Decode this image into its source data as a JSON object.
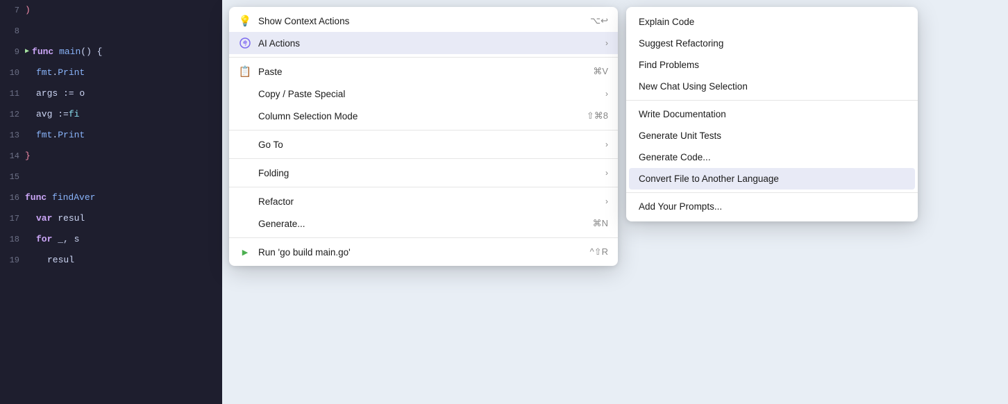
{
  "editor": {
    "lines": [
      {
        "num": "7",
        "content": ")",
        "type": "bracket",
        "hasRun": false
      },
      {
        "num": "8",
        "content": "",
        "type": "empty",
        "hasRun": false
      },
      {
        "num": "9",
        "content": "func main() {",
        "type": "func",
        "hasRun": true
      },
      {
        "num": "10",
        "content": "    fmt.Print",
        "type": "code",
        "hasRun": false
      },
      {
        "num": "11",
        "content": "    args := o",
        "type": "code",
        "hasRun": false
      },
      {
        "num": "12",
        "content": "    avg := fi",
        "type": "code",
        "hasRun": false
      },
      {
        "num": "13",
        "content": "    fmt.Print",
        "type": "code",
        "hasRun": false
      },
      {
        "num": "14",
        "content": "}",
        "type": "bracket",
        "hasRun": false
      },
      {
        "num": "15",
        "content": "",
        "type": "empty",
        "hasRun": false
      },
      {
        "num": "16",
        "content": "func findAver",
        "type": "func",
        "hasRun": false
      },
      {
        "num": "17",
        "content": "    var resul",
        "type": "code",
        "hasRun": false
      },
      {
        "num": "18",
        "content": "    for _, s",
        "type": "code",
        "hasRun": false
      },
      {
        "num": "19",
        "content": "        resul",
        "type": "code",
        "hasRun": false
      }
    ]
  },
  "contextMenu": {
    "items": [
      {
        "id": "show-context-actions",
        "icon": "💡",
        "label": "Show Context Actions",
        "shortcut": "⌥↩",
        "hasArrow": false,
        "isDivider": false,
        "isHighlighted": false,
        "isRunItem": false
      },
      {
        "id": "ai-actions",
        "icon": "ai",
        "label": "AI Actions",
        "shortcut": "",
        "hasArrow": true,
        "isDivider": false,
        "isHighlighted": true,
        "isRunItem": false
      },
      {
        "id": "div1",
        "isDivider": true
      },
      {
        "id": "paste",
        "icon": "📋",
        "label": "Paste",
        "shortcut": "⌘V",
        "hasArrow": false,
        "isDivider": false,
        "isHighlighted": false,
        "isRunItem": false
      },
      {
        "id": "copy-paste-special",
        "icon": "",
        "label": "Copy / Paste Special",
        "shortcut": "",
        "hasArrow": true,
        "isDivider": false,
        "isHighlighted": false,
        "isRunItem": false
      },
      {
        "id": "column-selection",
        "icon": "",
        "label": "Column Selection Mode",
        "shortcut": "⇧⌘8",
        "hasArrow": false,
        "isDivider": false,
        "isHighlighted": false,
        "isRunItem": false
      },
      {
        "id": "div2",
        "isDivider": true
      },
      {
        "id": "go-to",
        "icon": "",
        "label": "Go To",
        "shortcut": "",
        "hasArrow": true,
        "isDivider": false,
        "isHighlighted": false,
        "isRunItem": false
      },
      {
        "id": "div3",
        "isDivider": true
      },
      {
        "id": "folding",
        "icon": "",
        "label": "Folding",
        "shortcut": "",
        "hasArrow": true,
        "isDivider": false,
        "isHighlighted": false,
        "isRunItem": false
      },
      {
        "id": "div4",
        "isDivider": true
      },
      {
        "id": "refactor",
        "icon": "",
        "label": "Refactor",
        "shortcut": "",
        "hasArrow": true,
        "isDivider": false,
        "isHighlighted": false,
        "isRunItem": false
      },
      {
        "id": "generate",
        "icon": "",
        "label": "Generate...",
        "shortcut": "⌘N",
        "hasArrow": false,
        "isDivider": false,
        "isHighlighted": false,
        "isRunItem": false
      },
      {
        "id": "div5",
        "isDivider": true
      },
      {
        "id": "run-build",
        "icon": "▶",
        "label": "Run 'go build main.go'",
        "shortcut": "^⇧R",
        "hasArrow": false,
        "isDivider": false,
        "isHighlighted": false,
        "isRunItem": true
      }
    ]
  },
  "submenu": {
    "items": [
      {
        "id": "explain-code",
        "label": "Explain Code",
        "isHighlighted": false
      },
      {
        "id": "suggest-refactoring",
        "label": "Suggest Refactoring",
        "isHighlighted": false
      },
      {
        "id": "find-problems",
        "label": "Find Problems",
        "isHighlighted": false
      },
      {
        "id": "new-chat",
        "label": "New Chat Using Selection",
        "isHighlighted": false
      },
      {
        "id": "div1",
        "isDivider": true
      },
      {
        "id": "write-docs",
        "label": "Write Documentation",
        "isHighlighted": false
      },
      {
        "id": "gen-unit-tests",
        "label": "Generate Unit Tests",
        "isHighlighted": false
      },
      {
        "id": "gen-code",
        "label": "Generate Code...",
        "isHighlighted": false
      },
      {
        "id": "convert-file",
        "label": "Convert File to Another Language",
        "isHighlighted": true
      },
      {
        "id": "div2",
        "isDivider": true
      },
      {
        "id": "add-prompts",
        "label": "Add Your Prompts...",
        "isHighlighted": false
      }
    ]
  }
}
